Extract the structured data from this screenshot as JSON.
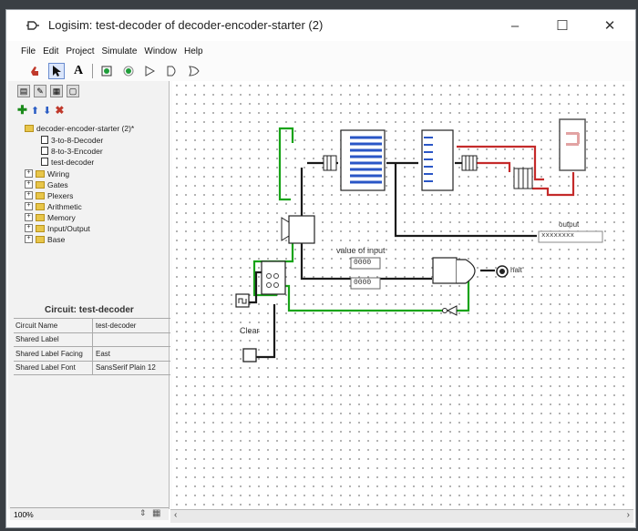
{
  "window": {
    "title": "Logisim: test-decoder of decoder-encoder-starter (2)",
    "minimize": "–",
    "maximize": "☐",
    "close": "✕"
  },
  "menu": [
    "File",
    "Edit",
    "Project",
    "Simulate",
    "Window",
    "Help"
  ],
  "toolbar": {
    "text_tool": "A"
  },
  "project_tree": {
    "root": "decoder-encoder-starter (2)*",
    "circuits": [
      "3-to-8-Decoder",
      "8-to-3-Encoder",
      "test-decoder"
    ],
    "libraries": [
      "Wiring",
      "Gates",
      "Plexers",
      "Arithmetic",
      "Memory",
      "Input/Output",
      "Base"
    ]
  },
  "attributes": {
    "title": "Circuit: test-decoder",
    "rows": [
      {
        "key": "Circuit Name",
        "value": "test-decoder"
      },
      {
        "key": "Shared Label",
        "value": ""
      },
      {
        "key": "Shared Label Facing",
        "value": "East"
      },
      {
        "key": "Shared Label Font",
        "value": "SansSerif Plain 12"
      }
    ]
  },
  "status": {
    "zoom": "100%"
  },
  "circuit": {
    "labels": {
      "value_of_input": "value of input",
      "register_top": "0000",
      "register_bottom": "0000",
      "output": "output",
      "output_value": "xxxxxxxx",
      "halt": "halt",
      "clear": "Clear"
    },
    "colors": {
      "wire_on": "#18a318",
      "wire_off": "#1a1a1a",
      "wire_error": "#c42a2a",
      "bus": "#2a56c6"
    }
  }
}
